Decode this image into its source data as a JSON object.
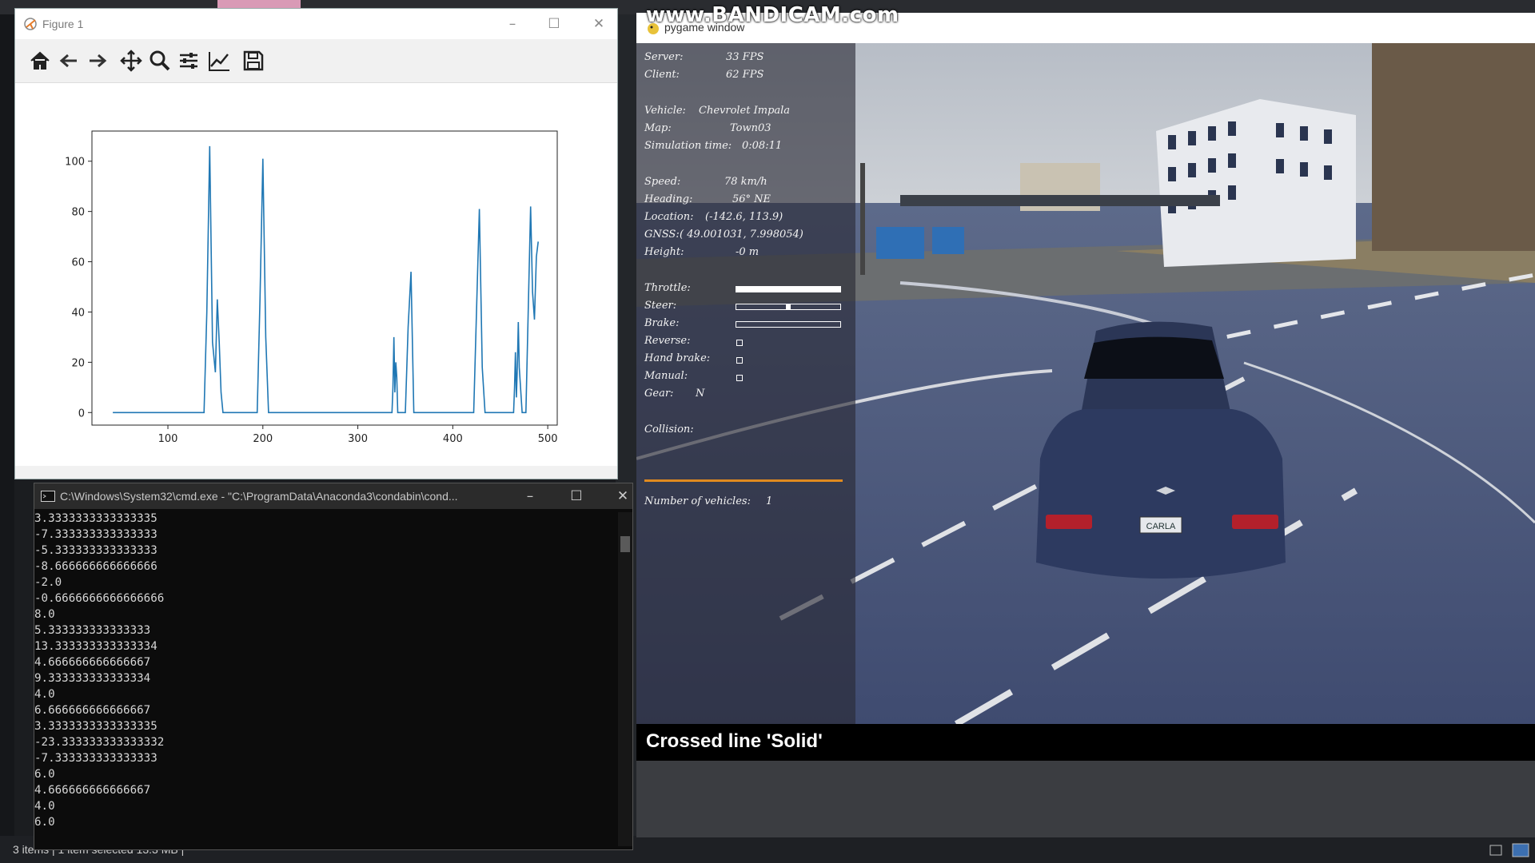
{
  "figure": {
    "title": "Figure 1",
    "toolbar": [
      "home-icon",
      "back-icon",
      "forward-icon",
      "pan-icon",
      "zoom-icon",
      "configure-subplots-icon",
      "edit-axis-icon",
      "save-icon"
    ]
  },
  "chart_data": {
    "type": "line",
    "title": "",
    "xlabel": "",
    "ylabel": "",
    "xlim": [
      20,
      510
    ],
    "ylim": [
      -5,
      112
    ],
    "xticks": [
      100,
      200,
      300,
      400,
      500
    ],
    "yticks": [
      0,
      20,
      40,
      60,
      80,
      100
    ],
    "color": "#1f77b4",
    "grid": false,
    "series": [
      {
        "x": [
          42,
          138,
          141,
          144,
          147,
          150,
          152,
          154,
          156,
          158,
          160,
          194,
          197,
          200,
          203,
          206,
          336,
          337,
          338,
          339,
          340,
          341,
          342,
          350,
          353,
          356,
          359,
          422,
          425,
          428,
          431,
          434,
          464,
          465,
          466,
          467,
          468,
          469,
          470,
          473,
          477,
          480,
          482,
          484,
          486,
          488,
          490
        ],
        "values": [
          0,
          0,
          40,
          106,
          28,
          16,
          45,
          28,
          8,
          0,
          0,
          0,
          45,
          101,
          30,
          0,
          0,
          10,
          30,
          8,
          20,
          14,
          0,
          0,
          34,
          56,
          0,
          0,
          40,
          81,
          18,
          0,
          0,
          10,
          24,
          6,
          18,
          36,
          18,
          0,
          0,
          50,
          82,
          48,
          37,
          62,
          68
        ]
      }
    ]
  },
  "cmd": {
    "title": "C:\\Windows\\System32\\cmd.exe - \"C:\\ProgramData\\Anaconda3\\condabin\\cond...",
    "lines": [
      "3.3333333333333335",
      "-7.333333333333333",
      "-5.333333333333333",
      "-8.666666666666666",
      "-2.0",
      "-0.6666666666666666",
      "8.0",
      "5.333333333333333",
      "13.333333333333334",
      "4.666666666666667",
      "9.333333333333334",
      "4.0",
      "6.666666666666667",
      "3.3333333333333335",
      "-23.333333333333332",
      "-7.333333333333333",
      "6.0",
      "4.666666666666667",
      "4.0",
      "6.0"
    ]
  },
  "explorer_status": "3 items  |  1 item selected  13.3 MB  |",
  "watermark": "www.BANDICAM.com",
  "pygame": {
    "title": "pygame window",
    "hud": {
      "server_label": "Server:",
      "server_value": "33 FPS",
      "client_label": "Client:",
      "client_value": "62 FPS",
      "vehicle_label": "Vehicle:",
      "vehicle_value": "Chevrolet Impala",
      "map_label": "Map:",
      "map_value": "Town03",
      "simtime_label": "Simulation time:",
      "simtime_value": "0:08:11",
      "speed_label": "Speed:",
      "speed_value": "78 km/h",
      "heading_label": "Heading:",
      "heading_value": "56° NE",
      "location_label": "Location:",
      "location_value": "(-142.6, 113.9)",
      "gnss_label": "GNSS:",
      "gnss_value": "( 49.001031, 7.998054)",
      "height_label": "Height:",
      "height_value": "-0 m",
      "throttle_label": "Throttle:",
      "throttle": 1.0,
      "steer_label": "Steer:",
      "steer": 0.0,
      "brake_label": "Brake:",
      "brake": 0.0,
      "reverse_label": "Reverse:",
      "handbrake_label": "Hand brake:",
      "manual_label": "Manual:",
      "gear_label": "Gear:",
      "gear_value": "N",
      "collision_label": "Collision:",
      "vehicles_label": "Number of vehicles:",
      "vehicles_value": "1"
    },
    "plate": "CARLA",
    "notification": "Crossed line 'Solid'"
  }
}
